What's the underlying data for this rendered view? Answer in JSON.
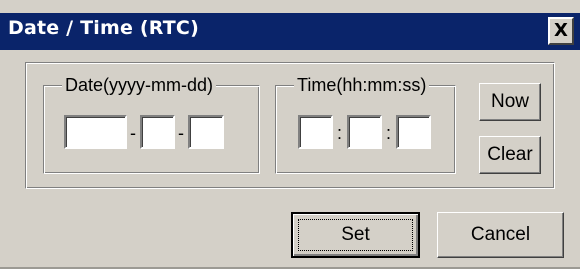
{
  "window": {
    "title": "Date / Time (RTC)",
    "close_label": "X"
  },
  "date_group": {
    "label": "Date(yyyy-mm-dd)",
    "separator": "-",
    "fields": {
      "year": "",
      "month": "",
      "day": ""
    }
  },
  "time_group": {
    "label": "Time(hh:mm:ss)",
    "separator": ":",
    "fields": {
      "hour": "",
      "minute": "",
      "second": ""
    }
  },
  "buttons": {
    "now": "Now",
    "clear": "Clear",
    "set": "Set",
    "cancel": "Cancel"
  }
}
